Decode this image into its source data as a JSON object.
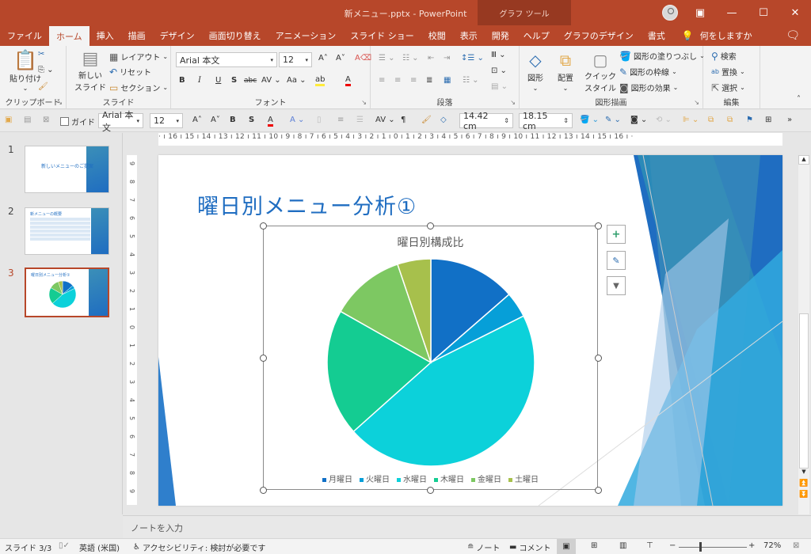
{
  "window": {
    "title": "新メニュー.pptx  -  PowerPoint",
    "context_tab_group": "グラフ ツール",
    "controls": {
      "ribbon_display": "▣",
      "minimize": "—",
      "maximize": "☐",
      "close": "✕"
    }
  },
  "tabs": [
    {
      "label": "ファイル",
      "active": false
    },
    {
      "label": "ホーム",
      "active": true
    },
    {
      "label": "挿入",
      "active": false
    },
    {
      "label": "描画",
      "active": false
    },
    {
      "label": "デザイン",
      "active": false
    },
    {
      "label": "画面切り替え",
      "active": false
    },
    {
      "label": "アニメーション",
      "active": false
    },
    {
      "label": "スライド ショー",
      "active": false
    },
    {
      "label": "校閲",
      "active": false
    },
    {
      "label": "表示",
      "active": false
    },
    {
      "label": "開発",
      "active": false
    },
    {
      "label": "ヘルプ",
      "active": false
    },
    {
      "label": "グラフのデザイン",
      "active": false
    },
    {
      "label": "書式",
      "active": false
    }
  ],
  "tell_me": "何をしますか",
  "ribbon": {
    "clipboard": {
      "label": "クリップボード",
      "paste": "貼り付け"
    },
    "slides": {
      "label": "スライド",
      "new_slide": "新しい",
      "new_slide2": "スライド",
      "layout": "レイアウト",
      "reset": "リセット",
      "section": "セクション"
    },
    "font": {
      "label": "フォント",
      "font_name": "Arial 本文",
      "font_size": "12"
    },
    "paragraph": {
      "label": "段落"
    },
    "drawing": {
      "label": "図形描画",
      "shapes": "図形",
      "arrange": "配置",
      "quick_style": "クイック",
      "quick_style2": "スタイル",
      "fill": "図形の塗りつぶし",
      "outline": "図形の枠線",
      "effects": "図形の効果"
    },
    "editing": {
      "label": "編集",
      "find": "検索",
      "replace": "置換",
      "select": "選択"
    }
  },
  "format_toolbar": {
    "guide": "ガイド",
    "font_name": "Arial 本文",
    "font_size": "12",
    "height": "14.42 cm",
    "width": "18.15 cm"
  },
  "rulers": {
    "horizontal": "· ı 16 ı 15 ı 14 ı 13 ı 12 ı 11 ı 10 ı 9 ı 8 ı 7 ı 6 ı 5 ı 4 ı 3 ı 2 ı 1 ı 0 ı 1 ı 2 ı 3 ı 4 ı 5 ı 6 ı 7 ı 8 ı 9 ı 10 ı 11 ı 12 ı 13 ı 14 ı 15 ı 16 ı ·",
    "vertical": [
      "9",
      "8",
      "7",
      "6",
      "5",
      "4",
      "3",
      "2",
      "1",
      "0",
      "1",
      "2",
      "3",
      "4",
      "5",
      "6",
      "7",
      "8",
      "9"
    ]
  },
  "thumbnails": [
    {
      "number": "1",
      "title": "新しいメニューのご提案",
      "selected": false
    },
    {
      "number": "2",
      "title": "新メニューの概要",
      "selected": false
    },
    {
      "number": "3",
      "title": "曜日別メニュー分析①",
      "selected": true
    }
  ],
  "slide": {
    "title": "曜日別メニュー分析①"
  },
  "chart_side_buttons": [
    {
      "name": "chart-elements",
      "glyph": "+"
    },
    {
      "name": "chart-styles",
      "glyph": "🖌"
    },
    {
      "name": "chart-filters",
      "glyph": "▼"
    }
  ],
  "chart_data": {
    "type": "pie",
    "title": "曜日別構成比",
    "categories": [
      "月曜日",
      "火曜日",
      "水曜日",
      "木曜日",
      "金曜日",
      "土曜日"
    ],
    "values": [
      13.6,
      4.0,
      45.8,
      19.8,
      11.6,
      5.2
    ],
    "unit": "%",
    "colors": [
      "#1170c6",
      "#069fd8",
      "#0cd1da",
      "#14cc92",
      "#7dc862",
      "#a7c04c"
    ],
    "legend_position": "bottom",
    "start_angle": "12 o'clock, clockwise"
  },
  "notes": {
    "placeholder": "ノートを入力"
  },
  "statusbar": {
    "slide": "スライド 3/3",
    "language": "英語 (米国)",
    "accessibility": "アクセシビリティ: 検討が必要です",
    "notes": "ノート",
    "comments": "コメント",
    "zoom": "72%",
    "zoom_level": 0.72
  }
}
